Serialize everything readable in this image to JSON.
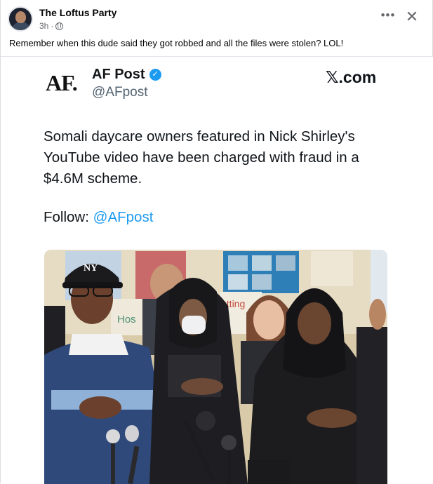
{
  "post": {
    "page_name": "The Loftus Party",
    "timestamp": "3h",
    "separator": "·",
    "privacy_icon": "globe-icon",
    "more_label": "•••",
    "close_label": "✕",
    "caption": "Remember when this dude said they got robbed and all the files were stolen? LOL!"
  },
  "tweet": {
    "logo_text": "AF.",
    "account_name": "AF Post",
    "verified_icon": "verified-badge-icon",
    "verified_glyph": "✓",
    "handle": "@AFpost",
    "brand": "𝕏.com",
    "text": "Somali daycare owners featured in Nick Shirley's YouTube video have been charged with fraud in a $4.6M scheme.",
    "follow_label": "Follow:",
    "follow_handle": "@AFpost"
  },
  "photo": {
    "cap_letters": "NY",
    "sign_text": "Hos",
    "poster_text": "utting"
  },
  "colors": {
    "link_blue": "#1d9bf0",
    "meta_gray": "#65676b",
    "text_dark": "#050505"
  }
}
